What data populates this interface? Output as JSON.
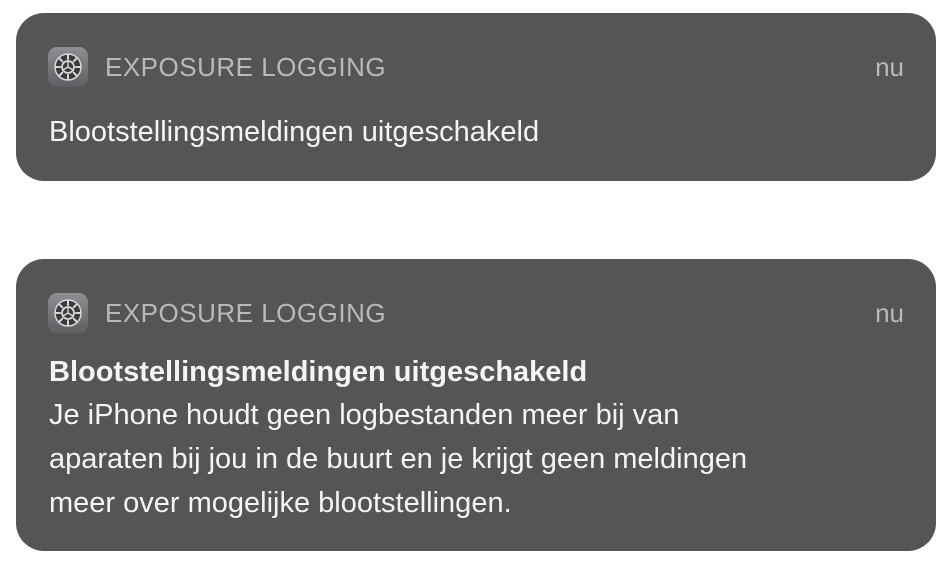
{
  "notifications": [
    {
      "app_name": "EXPOSURE LOGGING",
      "time": "nu",
      "title": "Blootstellingsmeldingen uitgeschakeld",
      "icon": "settings-gear-icon"
    },
    {
      "app_name": "EXPOSURE LOGGING",
      "time": "nu",
      "title": "Blootstellingsmeldingen uitgeschakeld",
      "body_lines": [
        "Je iPhone houdt geen logbestanden meer bij van",
        "aparaten bij jou in de buurt en je krijgt geen meldingen",
        "meer over mogelijke blootstellingen."
      ],
      "icon": "settings-gear-icon"
    }
  ],
  "colors": {
    "card_background": "#555555",
    "header_text": "#b9b9b9",
    "body_text": "#f4f4f4"
  }
}
